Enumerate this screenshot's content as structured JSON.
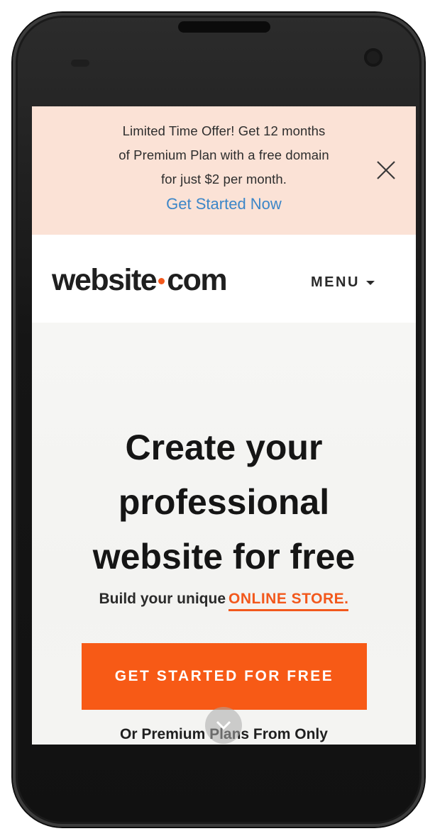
{
  "promo": {
    "line1": "Limited Time Offer! Get 12 months",
    "line2": "of Premium Plan with a free domain",
    "line3": "for just $2 per month.",
    "link": "Get Started Now",
    "close_icon": "close-icon"
  },
  "header": {
    "logo_left": "website",
    "logo_right": "com",
    "menu_label": "MENU",
    "menu_icon": "caret-down-icon"
  },
  "hero": {
    "headline_line1": "Create your",
    "headline_line2": "professional",
    "headline_line3": "website for free",
    "subline_prefix": "Build your unique",
    "subline_highlight": "ONLINE STORE.",
    "cta_label": "GET STARTED FOR FREE",
    "plans_text": "Or Premium Plans From Only",
    "scroll_icon": "chevron-down-icon"
  },
  "colors": {
    "accent": "#f75a16",
    "promo_bg": "#fbe2d6",
    "link": "#3c86c8"
  }
}
